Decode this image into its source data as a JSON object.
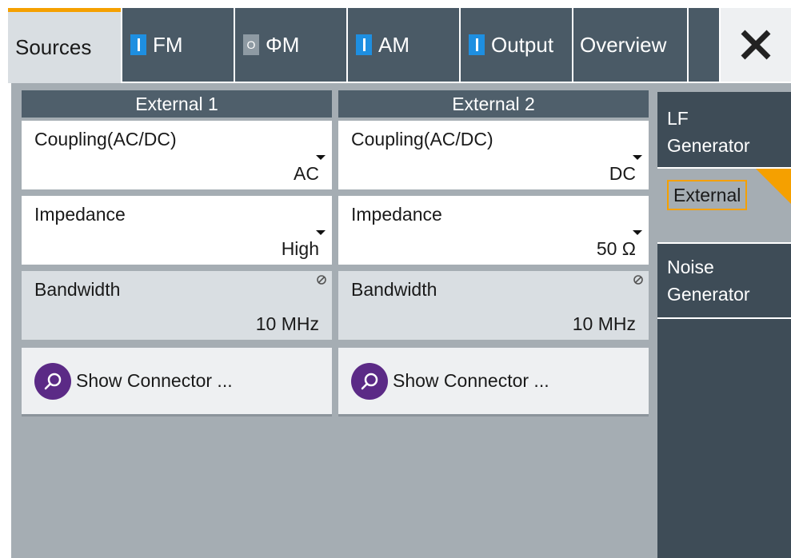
{
  "tabs": [
    {
      "label": "Sources",
      "state": null,
      "active": true
    },
    {
      "label": "FM",
      "state": "I",
      "active": false
    },
    {
      "label": "ΦM",
      "state": "O",
      "active": false
    },
    {
      "label": "AM",
      "state": "I",
      "active": false
    },
    {
      "label": "Output",
      "state": "I",
      "active": false
    },
    {
      "label": "Overview",
      "state": null,
      "active": false
    }
  ],
  "close_icon": "close-icon",
  "columns": [
    {
      "header": "External 1",
      "coupling": {
        "label": "Coupling(AC/DC)",
        "value": "AC"
      },
      "impedance": {
        "label": "Impedance",
        "value": "High"
      },
      "bandwidth": {
        "label": "Bandwidth",
        "value": "10 MHz"
      },
      "connector_button": "Show Connector ..."
    },
    {
      "header": "External 2",
      "coupling": {
        "label": "Coupling(AC/DC)",
        "value": "DC"
      },
      "impedance": {
        "label": "Impedance",
        "value": "50 Ω"
      },
      "bandwidth": {
        "label": "Bandwidth",
        "value": "10 MHz"
      },
      "connector_button": "Show Connector ..."
    }
  ],
  "side_nav": [
    {
      "label_line1": "LF",
      "label_line2": "Generator",
      "active": false
    },
    {
      "label": "External",
      "active": true
    },
    {
      "label_line1": "Noise",
      "label_line2": "Generator",
      "active": false
    }
  ],
  "colors": {
    "accent": "#f5a000",
    "state_on": "#1e8fe1",
    "tab_bg": "#4a5a66",
    "panel_bg": "#a5adb3",
    "button_icon_bg": "#5b2a86"
  }
}
